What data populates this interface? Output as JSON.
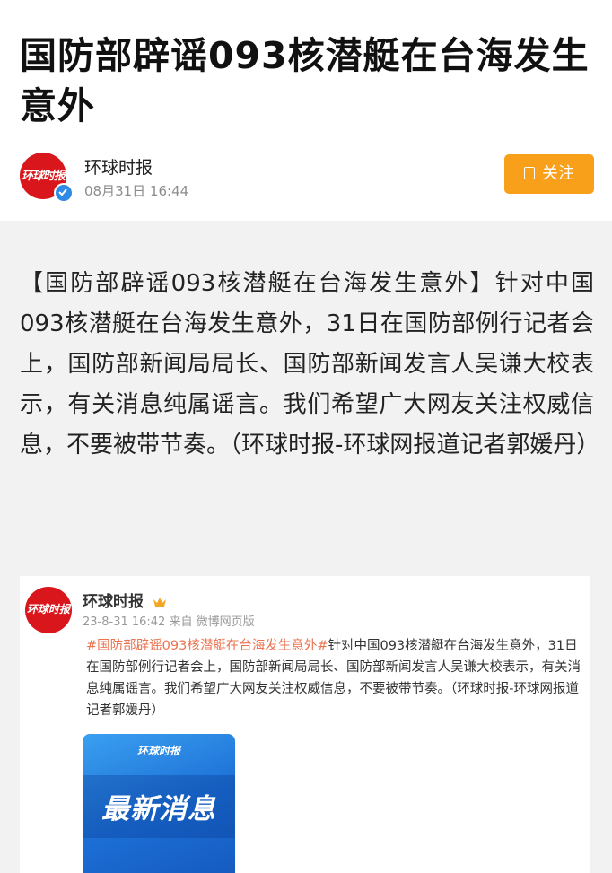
{
  "article": {
    "title": "国防部辟谣093核潜艇在台海发生意外",
    "author": "环球时报",
    "time": "08月31日  16:44",
    "follow_label": "关注",
    "avatar_logo": "环球时报",
    "body": "【国防部辟谣093核潜艇在台海发生意外】针对中国093核潜艇在台海发生意外，31日在国防部例行记者会上，国防部新闻局局长、国防部新闻发言人吴谦大校表示，有关消息纯属谣言。我们希望广大网友关注权威信息，不要被带节奏。（环球时报-环球网报道记者郭媛丹）"
  },
  "embedded_post": {
    "author": "环球时报",
    "avatar_logo": "环球时报",
    "meta": "23-8-31 16:42  来自 微博网页版",
    "hashtag": "#国防部辟谣093核潜艇在台海发生意外#",
    "text": "针对中国093核潜艇在台海发生意外，31日在国防部例行记者会上，国防部新闻局局长、国防部新闻发言人吴谦大校表示，有关消息纯属谣言。我们希望广大网友关注权威信息，不要被带节奏。（环球时报-环球网报道记者郭媛丹）",
    "image_logo": "环球时报",
    "image_text": "最新消息"
  },
  "colors": {
    "follow_button": "#f9a01b",
    "brand_red": "#d9161b",
    "hashtag": "#eb7350",
    "verify_blue": "#2f8ae5",
    "image_blue": "#1c6fd6"
  },
  "icons": [
    "verified-badge-icon",
    "follow-plus-icon",
    "crown-icon"
  ]
}
